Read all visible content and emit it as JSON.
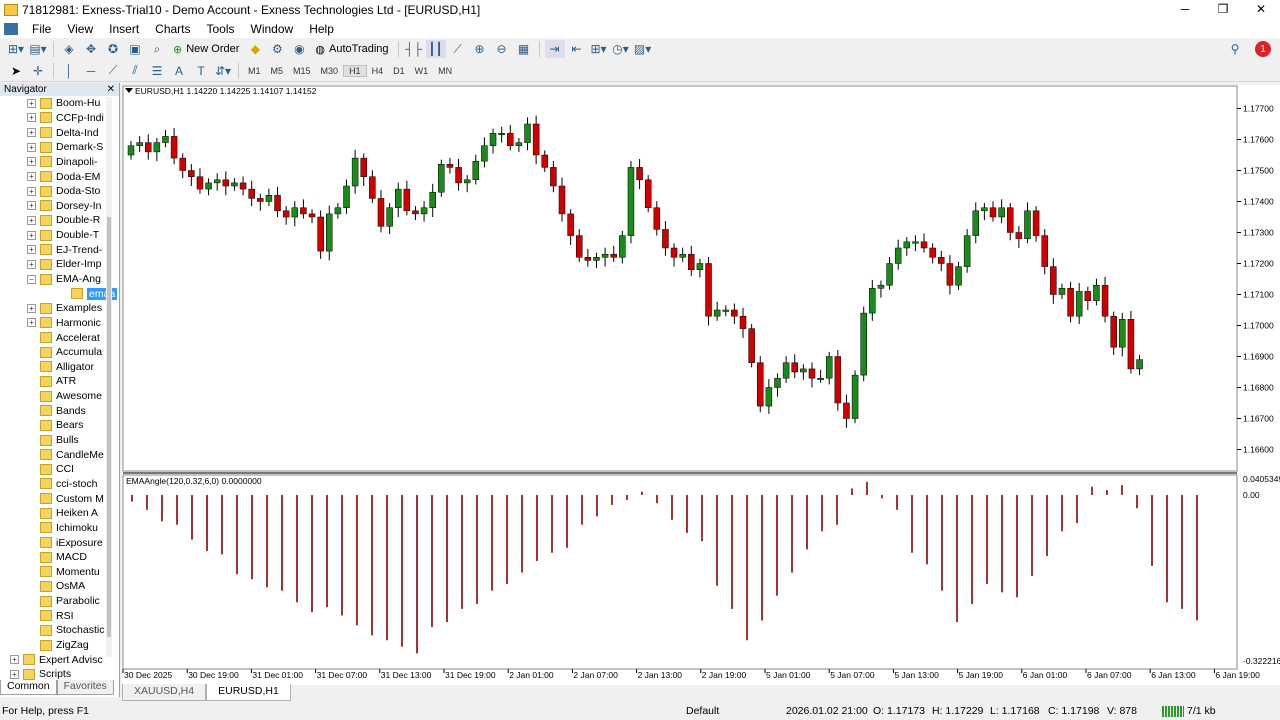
{
  "window": {
    "title": "71812981: Exness-Trial10 - Demo Account - Exness Technologies Ltd - [EURUSD,H1]",
    "controls": [
      "─",
      "❐",
      "✕"
    ]
  },
  "menu": [
    "File",
    "View",
    "Insert",
    "Charts",
    "Tools",
    "Window",
    "Help"
  ],
  "toolbar": {
    "new_order": "New Order",
    "autotrading": "AutoTrading"
  },
  "timeframes": [
    "M1",
    "M5",
    "M15",
    "M30",
    "H1",
    "H4",
    "D1",
    "W1",
    "MN"
  ],
  "active_timeframe": "H1",
  "navigator": {
    "title": "Navigator",
    "items": [
      {
        "label": "Boom-Hu",
        "level": 2,
        "exp": "+"
      },
      {
        "label": "CCFp-Indi",
        "level": 2,
        "exp": "+"
      },
      {
        "label": "Delta-Ind",
        "level": 2,
        "exp": "+"
      },
      {
        "label": "Demark-S",
        "level": 2,
        "exp": "+"
      },
      {
        "label": "Dinapoli-",
        "level": 2,
        "exp": "+"
      },
      {
        "label": "Doda-EM",
        "level": 2,
        "exp": "+"
      },
      {
        "label": "Doda-Sto",
        "level": 2,
        "exp": "+"
      },
      {
        "label": "Dorsey-In",
        "level": 2,
        "exp": "+"
      },
      {
        "label": "Double-R",
        "level": 2,
        "exp": "+"
      },
      {
        "label": "Double-T",
        "level": 2,
        "exp": "+"
      },
      {
        "label": "EJ-Trend-",
        "level": 2,
        "exp": "+"
      },
      {
        "label": "Elder-Imp",
        "level": 2,
        "exp": "+"
      },
      {
        "label": "EMA-Ang",
        "level": 2,
        "exp": "−"
      },
      {
        "label": "emaa",
        "level": 3,
        "exp": "",
        "selected": true
      },
      {
        "label": "Examples",
        "level": 2,
        "exp": "+"
      },
      {
        "label": "Harmonic",
        "level": 2,
        "exp": "+"
      },
      {
        "label": "Accelerat",
        "level": 2,
        "exp": ""
      },
      {
        "label": "Accumula",
        "level": 2,
        "exp": ""
      },
      {
        "label": "Alligator",
        "level": 2,
        "exp": ""
      },
      {
        "label": "ATR",
        "level": 2,
        "exp": ""
      },
      {
        "label": "Awesome",
        "level": 2,
        "exp": ""
      },
      {
        "label": "Bands",
        "level": 2,
        "exp": ""
      },
      {
        "label": "Bears",
        "level": 2,
        "exp": ""
      },
      {
        "label": "Bulls",
        "level": 2,
        "exp": ""
      },
      {
        "label": "CandleMe",
        "level": 2,
        "exp": ""
      },
      {
        "label": "CCI",
        "level": 2,
        "exp": ""
      },
      {
        "label": "cci-stoch",
        "level": 2,
        "exp": ""
      },
      {
        "label": "Custom M",
        "level": 2,
        "exp": ""
      },
      {
        "label": "Heiken A",
        "level": 2,
        "exp": ""
      },
      {
        "label": "Ichimoku",
        "level": 2,
        "exp": ""
      },
      {
        "label": "iExposure",
        "level": 2,
        "exp": ""
      },
      {
        "label": "MACD",
        "level": 2,
        "exp": ""
      },
      {
        "label": "Momentu",
        "level": 2,
        "exp": ""
      },
      {
        "label": "OsMA",
        "level": 2,
        "exp": ""
      },
      {
        "label": "Parabolic",
        "level": 2,
        "exp": ""
      },
      {
        "label": "RSI",
        "level": 2,
        "exp": ""
      },
      {
        "label": "Stochastic",
        "level": 2,
        "exp": ""
      },
      {
        "label": "ZigZag",
        "level": 2,
        "exp": ""
      },
      {
        "label": "Expert Advisc",
        "level": 1,
        "exp": "+"
      },
      {
        "label": "Scripts",
        "level": 1,
        "exp": "+"
      }
    ],
    "tabs": [
      "Common",
      "Favorites"
    ]
  },
  "chart": {
    "header": "EURUSD,H1  1.14220 1.14225 1.14107 1.14152",
    "indicator_header": "EMAAngle(120,0.32,6,0) 0.0000000",
    "price_labels": [
      "1.17700",
      "1.17600",
      "1.17500",
      "1.17400",
      "1.17300",
      "1.17200",
      "1.17100",
      "1.17000",
      "1.16900",
      "1.16800",
      "1.16700",
      "1.16600"
    ],
    "indicator_labels": [
      "0.0405349",
      "0.00",
      "-0.322216"
    ],
    "time_labels": [
      "30 Dec 2025",
      "30 Dec 19:00",
      "31 Dec 01:00",
      "31 Dec 07:00",
      "31 Dec 13:00",
      "31 Dec 19:00",
      "2 Jan 01:00",
      "2 Jan 07:00",
      "2 Jan 13:00",
      "2 Jan 19:00",
      "5 Jan 01:00",
      "5 Jan 07:00",
      "5 Jan 13:00",
      "5 Jan 19:00",
      "6 Jan 01:00",
      "6 Jan 07:00",
      "6 Jan 13:00",
      "6 Jan 19:00"
    ],
    "colors": {
      "bull": "#1a8a1a",
      "bear": "#d10000",
      "indicator": "#8b0000"
    },
    "candle_closes": [
      1.1758,
      1.1759,
      1.1756,
      1.1759,
      1.1761,
      1.1754,
      1.175,
      1.1748,
      1.1744,
      1.1746,
      1.1747,
      1.1745,
      1.1746,
      1.1744,
      1.1741,
      1.174,
      1.1742,
      1.1737,
      1.1735,
      1.1738,
      1.1736,
      1.1735,
      1.1724,
      1.1736,
      1.1738,
      1.1745,
      1.1754,
      1.1748,
      1.1741,
      1.1732,
      1.1738,
      1.1744,
      1.1737,
      1.1736,
      1.1738,
      1.1743,
      1.1752,
      1.1751,
      1.1746,
      1.1747,
      1.1753,
      1.1758,
      1.1762,
      1.1762,
      1.1758,
      1.1759,
      1.1765,
      1.1755,
      1.1751,
      1.1745,
      1.1736,
      1.1729,
      1.1722,
      1.1721,
      1.1722,
      1.1723,
      1.1722,
      1.1729,
      1.1751,
      1.1747,
      1.1738,
      1.1731,
      1.1725,
      1.1722,
      1.1723,
      1.1718,
      1.172,
      1.1703,
      1.1705,
      1.1705,
      1.1703,
      1.1699,
      1.1688,
      1.1674,
      1.168,
      1.1683,
      1.1688,
      1.1685,
      1.1686,
      1.1683,
      1.1683,
      1.169,
      1.1675,
      1.167,
      1.1684,
      1.1704,
      1.1712,
      1.1713,
      1.172,
      1.1725,
      1.1727,
      1.1727,
      1.1725,
      1.1722,
      1.172,
      1.1713,
      1.1719,
      1.1729,
      1.1737,
      1.1738,
      1.1735,
      1.1738,
      1.173,
      1.1728,
      1.1737,
      1.1729,
      1.1719,
      1.171,
      1.1712,
      1.1703,
      1.1711,
      1.1708,
      1.1713,
      1.1703,
      1.1693,
      1.1702,
      1.1686,
      1.1689
    ],
    "indicator_values": [
      -0.04,
      -0.09,
      -0.16,
      -0.18,
      -0.27,
      -0.34,
      -0.36,
      -0.48,
      -0.51,
      -0.56,
      -0.58,
      -0.65,
      -0.71,
      -0.68,
      -0.73,
      -0.79,
      -0.85,
      -0.88,
      -0.92,
      -0.96,
      -0.8,
      -0.77,
      -0.69,
      -0.66,
      -0.58,
      -0.54,
      -0.47,
      -0.4,
      -0.35,
      -0.32,
      -0.18,
      -0.13,
      -0.06,
      -0.03,
      0.02,
      -0.05,
      -0.15,
      -0.23,
      -0.28,
      -0.55,
      -0.69,
      -0.88,
      -0.76,
      -0.61,
      -0.47,
      -0.33,
      -0.22,
      -0.18,
      0.04,
      0.08,
      -0.02,
      -0.09,
      -0.35,
      -0.42,
      -0.58,
      -0.77,
      -0.66,
      -0.54,
      -0.59,
      -0.62,
      -0.49,
      -0.37,
      -0.22,
      -0.17,
      0.05,
      0.03,
      0.06,
      -0.08,
      -0.43,
      -0.65,
      -0.69,
      -0.76
    ]
  },
  "chart_tabs": [
    "XAUUSD,H4",
    "EURUSD,H1"
  ],
  "status": {
    "help": "For Help, press F1",
    "profile": "Default",
    "datetime": "2026.01.02 21:00",
    "open": "O: 1.17173",
    "high": "H: 1.17229",
    "low": "L: 1.17168",
    "close": "C: 1.17198",
    "volume": "V: 878",
    "traffic": "7/1 kb"
  }
}
